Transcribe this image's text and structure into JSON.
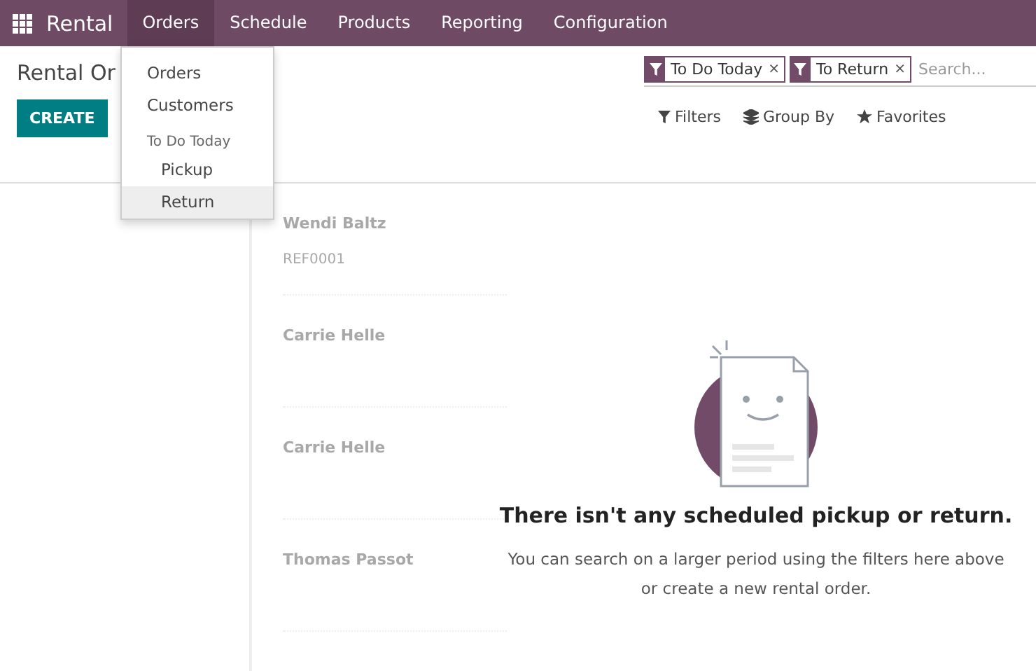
{
  "navbar": {
    "app_name": "Rental",
    "menus": [
      {
        "label": "Orders",
        "selected": true
      },
      {
        "label": "Schedule",
        "selected": false
      },
      {
        "label": "Products",
        "selected": false
      },
      {
        "label": "Reporting",
        "selected": false
      },
      {
        "label": "Configuration",
        "selected": false
      }
    ]
  },
  "dropdown": {
    "items": [
      {
        "kind": "item",
        "label": "Orders",
        "selected": false
      },
      {
        "kind": "item",
        "label": "Customers",
        "selected": false
      },
      {
        "kind": "header",
        "label": "To Do Today"
      },
      {
        "kind": "subitem",
        "label": "Pickup",
        "selected": false
      },
      {
        "kind": "subitem",
        "label": "Return",
        "selected": true
      }
    ]
  },
  "breadcrumb": "Rental Or",
  "create_button": "CREATE",
  "search": {
    "facets": [
      "To Do Today",
      "To Return"
    ],
    "remove": "×",
    "placeholder": "Search..."
  },
  "search_options": [
    {
      "kind": "filter",
      "label": "Filters"
    },
    {
      "kind": "group",
      "label": "Group By"
    },
    {
      "kind": "favorite",
      "label": "Favorites"
    }
  ],
  "ghost_cards": [
    {
      "name": "Wendi Baltz",
      "ref": "REF0001"
    },
    {
      "name": "Carrie Helle"
    },
    {
      "name": "Carrie Helle"
    },
    {
      "name": "Thomas Passot"
    }
  ],
  "empty_state": {
    "title": "There isn't any scheduled pickup or return.",
    "lines": [
      "You can search on a larger period using the filters here above",
      "or create a new rental order."
    ]
  }
}
